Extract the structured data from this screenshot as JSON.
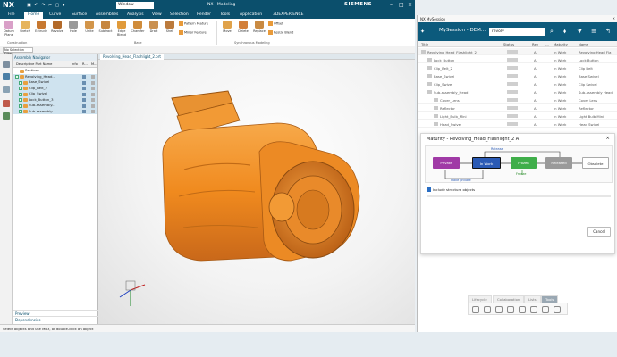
{
  "nx": {
    "title_bar": {
      "logo": "NX",
      "window_menu": "Window",
      "title": "NX - Modeling",
      "brand": "SIEMENS"
    },
    "menu": [
      "File",
      "Home",
      "Curve",
      "Surface",
      "Assemblies",
      "Analysis",
      "View",
      "Selection",
      "Render",
      "Tools",
      "Application",
      "3DEXPERIENCE"
    ],
    "ribbon": {
      "buttons": [
        "Datum Plane",
        "Sketch",
        "Extrude",
        "Revolve",
        "Hole",
        "Unite",
        "Subtract",
        "Edge Blend",
        "Chamfer",
        "Draft",
        "Shell",
        "Move",
        "Delete",
        "Replace"
      ],
      "small": [
        "Pattern Feature",
        "Mirror Feature",
        "Offset",
        "Resize Blend"
      ],
      "groups": [
        "Construction",
        "Base",
        "Synchronous Modeling"
      ]
    },
    "command_bar": {
      "filter": "No Selection Filter"
    },
    "navigator": {
      "title": "Assembly Navigator",
      "columns": [
        "Descriptive Part Name",
        "Info",
        "R...",
        "M..."
      ],
      "rows": [
        {
          "label": "Sections",
          "level": 0,
          "checked": false,
          "selected": false
        },
        {
          "label": "Revolving_Head...",
          "level": 0,
          "checked": true,
          "selected": true
        },
        {
          "label": "Base_Swivel",
          "level": 1,
          "checked": true,
          "selected": true
        },
        {
          "label": "Clip_Belt_2",
          "level": 1,
          "checked": true,
          "selected": true
        },
        {
          "label": "Clip_Swivel",
          "level": 1,
          "checked": true,
          "selected": true
        },
        {
          "label": "Lock_Button_3",
          "level": 1,
          "checked": true,
          "selected": true
        },
        {
          "label": "Sub-assembly...",
          "level": 1,
          "checked": true,
          "selected": true
        },
        {
          "label": "Sub-assembly...",
          "level": 1,
          "checked": true,
          "selected": true
        }
      ],
      "footer": [
        "Preview",
        "Dependencies"
      ]
    },
    "viewport_tab": "Revolving_Head_Flashlight_2.prt",
    "status": "Select objects and use MB3, or double-click an object"
  },
  "teamcenter": {
    "header": "NX MySession",
    "session_label": "MySession - DEM...",
    "search_value": "revolv",
    "columns": [
      "Title",
      "Status",
      "Rev",
      "I...",
      "Maturity",
      "Name"
    ],
    "rows": [
      {
        "title": "Revolving_Head_Flashlight_2",
        "rev": "A",
        "maturity": "In Work",
        "name": "Revolving Head Fla",
        "indent": 0
      },
      {
        "title": "Lock_Button",
        "rev": "A",
        "maturity": "In Work",
        "name": "Lock Button",
        "indent": 1
      },
      {
        "title": "Clip_Belt_2",
        "rev": "A",
        "maturity": "In Work",
        "name": "Clip Belt",
        "indent": 1
      },
      {
        "title": "Base_Swivel",
        "rev": "A",
        "maturity": "In Work",
        "name": "Base Swivel",
        "indent": 1
      },
      {
        "title": "Clip_Swivel",
        "rev": "A",
        "maturity": "In Work",
        "name": "Clip Swivel",
        "indent": 1
      },
      {
        "title": "Sub-assembly_Head",
        "rev": "A",
        "maturity": "In Work",
        "name": "Sub-assembly Head",
        "indent": 1
      },
      {
        "title": "Cover_Lens",
        "rev": "A",
        "maturity": "In Work",
        "name": "Cover Lens",
        "indent": 2
      },
      {
        "title": "Reflector",
        "rev": "A",
        "maturity": "In Work",
        "name": "Reflector",
        "indent": 2
      },
      {
        "title": "Light_Bulb_Mini",
        "rev": "A",
        "maturity": "In Work",
        "name": "Light Bulb Mini",
        "indent": 2
      },
      {
        "title": "Head_Swivel",
        "rev": "A",
        "maturity": "In Work",
        "name": "Head Swivel",
        "indent": 2
      }
    ],
    "maturity_dialog": {
      "title": "Maturity - Revolving_Head_Flashlight_2 A",
      "states": [
        "Private",
        "In Work",
        "Frozen",
        "Released",
        "Obsolete"
      ],
      "links": [
        "Release",
        "Freeze",
        "Make private"
      ],
      "include_label": "Include structure objects",
      "cancel": "Cancel"
    },
    "panel_tabs": [
      "Lifecycle",
      "Collaboration",
      "Lists",
      "Tools"
    ]
  },
  "colors": {
    "nx_blue": "#0b4f6c",
    "model_orange": "#f08a1e",
    "private": "#a03aa6",
    "in_work": "#2a5ab5",
    "frozen": "#3fae4a",
    "released": "#9a9a9a"
  }
}
